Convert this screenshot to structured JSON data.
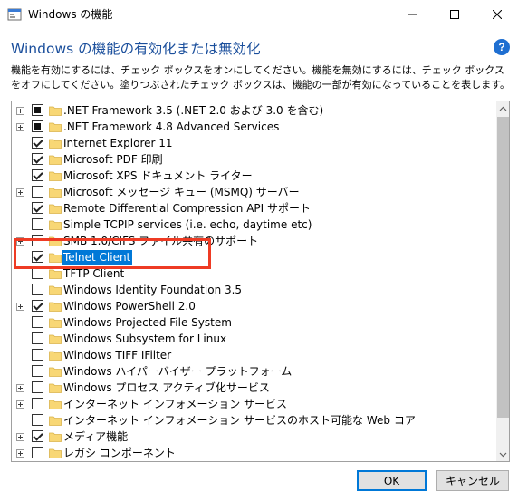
{
  "window": {
    "title": "Windows の機能",
    "heading": "Windows の機能の有効化または無効化",
    "description": "機能を有効にするには、チェック ボックスをオンにしてください。機能を無効にするには、チェック ボックスをオフにしてください。塗りつぶされたチェック ボックスは、機能の一部が有効になっていることを表します。",
    "help_glyph": "?"
  },
  "features": [
    {
      "label": ".NET Framework 3.5 (.NET 2.0 および 3.0 を含む)",
      "state": "partial",
      "expandable": true
    },
    {
      "label": ".NET Framework 4.8 Advanced Services",
      "state": "partial",
      "expandable": true
    },
    {
      "label": "Internet Explorer 11",
      "state": "checked",
      "expandable": false
    },
    {
      "label": "Microsoft PDF 印刷",
      "state": "checked",
      "expandable": false
    },
    {
      "label": "Microsoft XPS ドキュメント ライター",
      "state": "checked",
      "expandable": false
    },
    {
      "label": "Microsoft メッセージ キュー (MSMQ) サーバー",
      "state": "unchecked",
      "expandable": true
    },
    {
      "label": "Remote Differential Compression API サポート",
      "state": "checked",
      "expandable": false
    },
    {
      "label": "Simple TCPIP services (i.e. echo, daytime etc)",
      "state": "unchecked",
      "expandable": false
    },
    {
      "label": "SMB 1.0/CIFS ファイル共有のサポート",
      "state": "unchecked",
      "expandable": true
    },
    {
      "label": "Telnet Client",
      "state": "checked",
      "expandable": false,
      "selected": true
    },
    {
      "label": "TFTP Client",
      "state": "unchecked",
      "expandable": false
    },
    {
      "label": "Windows Identity Foundation 3.5",
      "state": "unchecked",
      "expandable": false
    },
    {
      "label": "Windows PowerShell 2.0",
      "state": "checked",
      "expandable": true
    },
    {
      "label": "Windows Projected File System",
      "state": "unchecked",
      "expandable": false
    },
    {
      "label": "Windows Subsystem for Linux",
      "state": "unchecked",
      "expandable": false
    },
    {
      "label": "Windows TIFF IFilter",
      "state": "unchecked",
      "expandable": false
    },
    {
      "label": "Windows ハイパーバイザー プラットフォーム",
      "state": "unchecked",
      "expandable": false
    },
    {
      "label": "Windows プロセス アクティブ化サービス",
      "state": "unchecked",
      "expandable": true
    },
    {
      "label": "インターネット インフォメーション サービス",
      "state": "unchecked",
      "expandable": true
    },
    {
      "label": "インターネット インフォメーション サービスのホスト可能な Web コア",
      "state": "unchecked",
      "expandable": false
    },
    {
      "label": "メディア機能",
      "state": "checked",
      "expandable": true
    },
    {
      "label": "レガシ コンポーネント",
      "state": "unchecked",
      "expandable": true
    }
  ],
  "buttons": {
    "ok": "OK",
    "cancel": "キャンセル"
  },
  "colors": {
    "heading": "#1b4f9c",
    "selection": "#0078d7",
    "highlight_box": "#ee3b24",
    "folder": "#f8d775"
  }
}
